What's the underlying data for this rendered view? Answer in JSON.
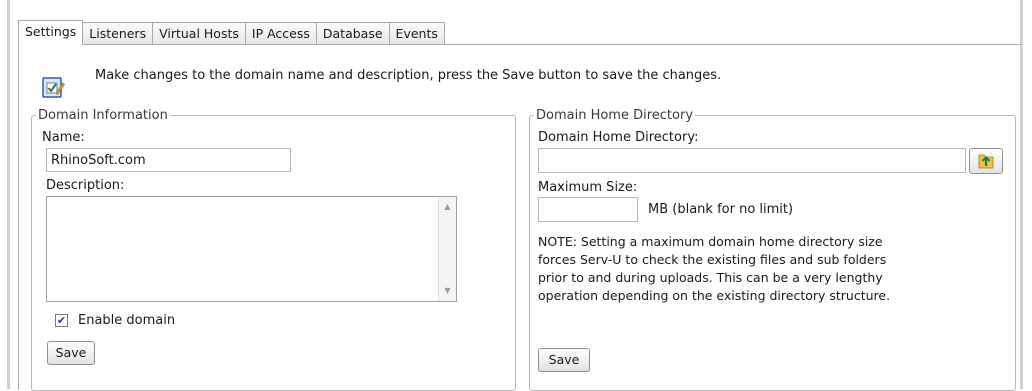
{
  "tabs": [
    {
      "label": "Settings",
      "active": true
    },
    {
      "label": "Listeners"
    },
    {
      "label": "Virtual Hosts"
    },
    {
      "label": "IP Access"
    },
    {
      "label": "Database"
    },
    {
      "label": "Events"
    }
  ],
  "intro": {
    "icon": "edit-checklist-icon",
    "text": "Make changes to the domain name and description, press the Save button to save the changes."
  },
  "domain_info": {
    "legend": "Domain Information",
    "name_label": "Name:",
    "name_value": "RhinoSoft.com",
    "description_label": "Description:",
    "description_value": "",
    "enable_label": "Enable domain",
    "enable_checked": true,
    "save_label": "Save"
  },
  "home_dir": {
    "legend": "Domain Home Directory",
    "dir_label": "Domain Home Directory:",
    "dir_value": "",
    "browse_icon": "folder-up-icon",
    "max_size_label": "Maximum Size:",
    "max_size_value": "",
    "mb_label": "MB (blank for no limit)",
    "note_lines": [
      "NOTE: Setting a maximum domain home directory size",
      "forces Serv-U to check the existing files and sub folders",
      "prior to and during uploads. This can be a very lengthy",
      "operation depending on the existing directory structure."
    ],
    "save_label": "Save"
  }
}
